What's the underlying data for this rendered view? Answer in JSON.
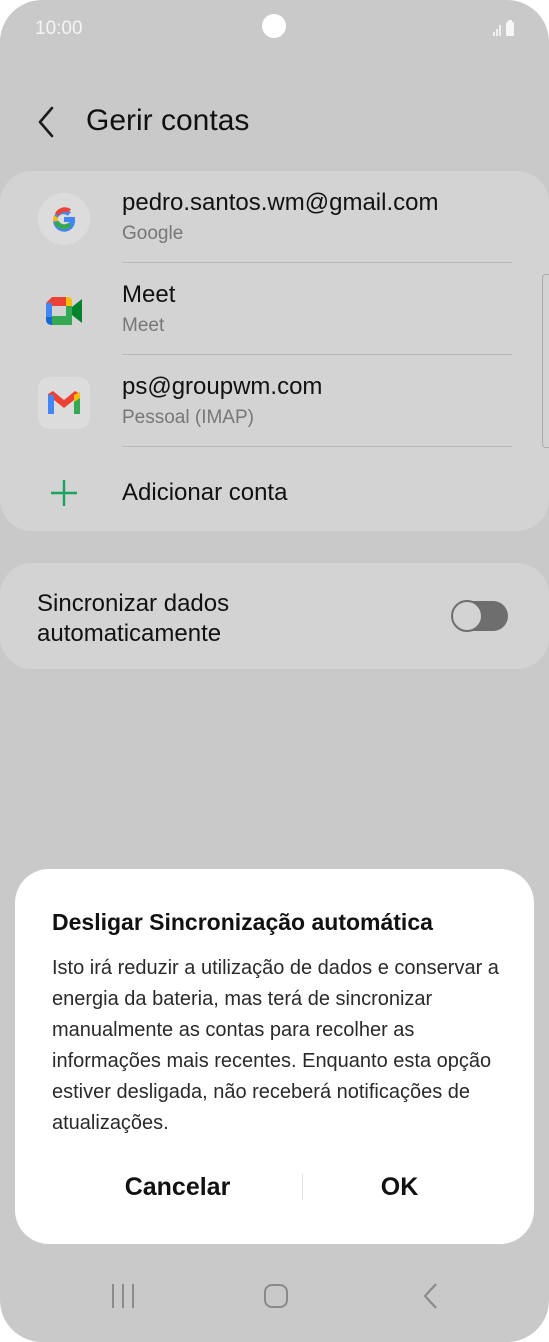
{
  "status": {
    "time": "10:00"
  },
  "appbar": {
    "title": "Gerir contas"
  },
  "accounts": [
    {
      "name": "pedro.santos.wm@gmail.com",
      "type": "Google"
    },
    {
      "name": "Meet",
      "type": "Meet"
    },
    {
      "name": "ps@groupwm.com",
      "type": "Pessoal (IMAP)"
    }
  ],
  "add_account": {
    "label": "Adicionar conta"
  },
  "sync": {
    "label": "Sincronizar dados automaticamente",
    "enabled": false
  },
  "dialog": {
    "title": "Desligar Sincronização automática",
    "body": "Isto irá reduzir a utilização de dados e conservar a energia da bateria, mas terá de sincronizar manualmente as contas para recolher as informações mais recentes. Enquanto esta opção estiver desligada, não receberá notificações de atualizações.",
    "cancel": "Cancelar",
    "ok": "OK"
  },
  "colors": {
    "accent_green": "#1aa260",
    "gmail_red": "#EA4335",
    "google_blue": "#4285F4",
    "google_yellow": "#FBBC05"
  }
}
